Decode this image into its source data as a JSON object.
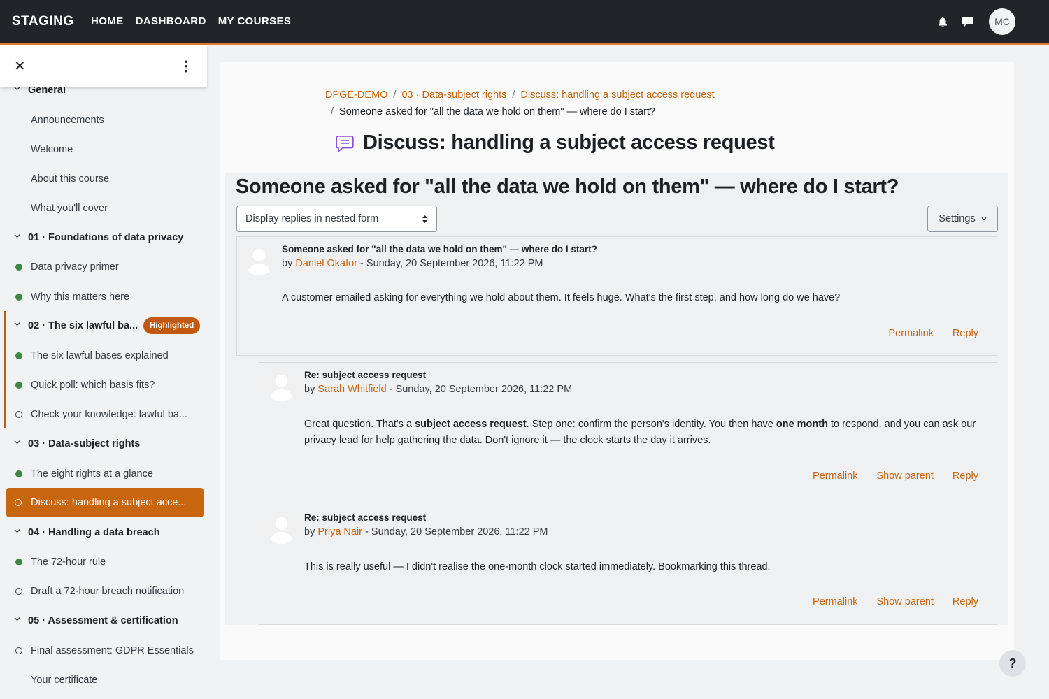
{
  "navbar": {
    "brand": "STAGING",
    "links": [
      "HOME",
      "DASHBOARD",
      "MY COURSES"
    ],
    "avatar_initials": "MC",
    "accent_color": "#e07a2b"
  },
  "sidebar": {
    "badge": "Highlighted",
    "items": [
      {
        "label": "General"
      },
      {
        "label": "Announcements"
      },
      {
        "label": "Welcome"
      },
      {
        "label": "About this course"
      },
      {
        "label": "What you'll cover"
      },
      {
        "label": "01 · Foundations of data privacy"
      },
      {
        "label": "Data privacy primer"
      },
      {
        "label": "Why this matters here"
      },
      {
        "label": "02 · The six lawful ba..."
      },
      {
        "label": "The six lawful bases explained"
      },
      {
        "label": "Quick poll: which basis fits?"
      },
      {
        "label": "Check your knowledge: lawful ba..."
      },
      {
        "label": "03 · Data-subject rights"
      },
      {
        "label": "The eight rights at a glance"
      },
      {
        "label": "Discuss: handling a subject acce..."
      },
      {
        "label": "04 · Handling a data breach"
      },
      {
        "label": "The 72-hour rule"
      },
      {
        "label": "Draft a 72-hour breach notification"
      },
      {
        "label": "05 · Assessment & certification"
      },
      {
        "label": "Final assessment: GDPR Essentials"
      },
      {
        "label": "Your certificate"
      }
    ]
  },
  "breadcrumb": {
    "items": [
      "DPGE-DEMO",
      "03 · Data-subject rights",
      "Discuss: handling a subject access request"
    ],
    "current": "Someone asked for \"all the data we hold on them\" — where do I start?"
  },
  "page": {
    "forum_title": "Discuss: handling a subject access request",
    "discussion_title": "Someone asked for \"all the data we hold on them\" — where do I start?",
    "display_mode": "Display replies in nested form",
    "settings_label": "Settings"
  },
  "posts": [
    {
      "subject": "Someone asked for \"all the data we hold on them\" — where do I start?",
      "by": "by",
      "author": "Daniel Okafor",
      "date": " - Sunday, 20 September 2026, 11:22 PM",
      "body": "A customer emailed asking for everything we hold about them. It feels huge. What's the first step, and how long do we have?",
      "actions": [
        "Permalink",
        "Reply"
      ]
    },
    {
      "subject": "Re: subject access request",
      "by": "by",
      "author": "Sarah Whitfield",
      "date": " - Sunday, 20 September 2026, 11:22 PM",
      "body_parts": [
        "Great question. That's a ",
        "subject access request",
        ". Step one: confirm the person's identity. You then have ",
        "one month",
        " to respond, and you can ask our privacy lead for help gathering the data. Don't ignore it — the clock starts the day it arrives."
      ],
      "actions": [
        "Permalink",
        "Show parent",
        "Reply"
      ]
    },
    {
      "subject": "Re: subject access request",
      "by": "by",
      "author": "Priya Nair",
      "date": " - Sunday, 20 September 2026, 11:22 PM",
      "body": "This is really useful — I didn't realise the one-month clock started immediately. Bookmarking this thread.",
      "actions": [
        "Permalink",
        "Show parent",
        "Reply"
      ]
    }
  ],
  "help": "?"
}
